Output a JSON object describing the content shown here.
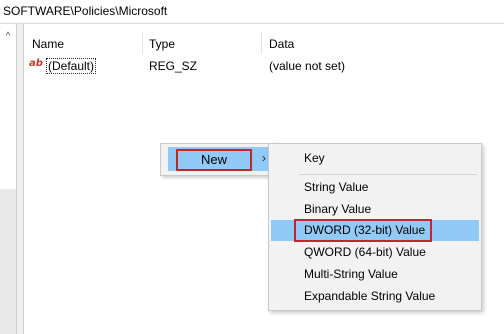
{
  "address": {
    "path": "SOFTWARE\\Policies\\Microsoft"
  },
  "columns": {
    "name": "Name",
    "type": "Type",
    "data": "Data"
  },
  "values": [
    {
      "icon": "string-value-icon",
      "icon_text": "ab",
      "name": "(Default)",
      "type": "REG_SZ",
      "data": "(value not set)"
    }
  ],
  "context_menu": {
    "new_label": "New",
    "arrow": "›"
  },
  "submenu": {
    "items": [
      "Key",
      "String Value",
      "Binary Value",
      "DWORD (32-bit) Value",
      "QWORD (64-bit) Value",
      "Multi-String Value",
      "Expandable String Value"
    ],
    "highlighted_index": 3
  },
  "tree": {
    "scroll_arrow": "^"
  },
  "colors": {
    "highlight": "#91c9f7",
    "annotation_box": "#c0272d",
    "menu_bg": "#f2f2f2"
  }
}
